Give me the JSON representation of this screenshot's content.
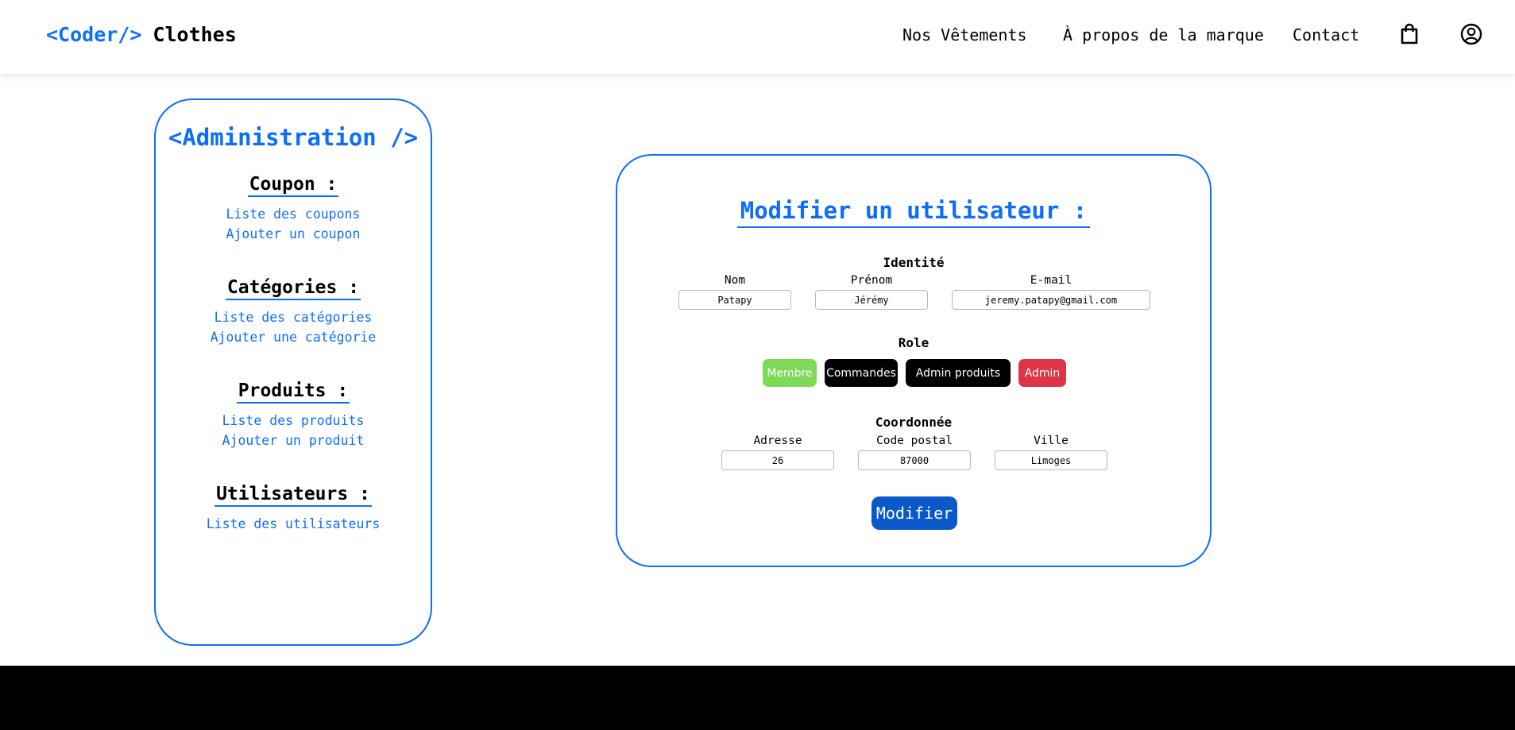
{
  "brand": {
    "code": "<Coder/>",
    "name": "Clothes"
  },
  "nav": {
    "items": [
      "Nos Vêtements",
      "À propos de la marque",
      "Contact"
    ],
    "icons": [
      "shopping-bag-icon",
      "user-circle-icon"
    ]
  },
  "sidebar": {
    "title": "<Administration />",
    "sections": [
      {
        "heading": "Coupon :",
        "links": [
          "Liste des coupons",
          "Ajouter un coupon"
        ]
      },
      {
        "heading": "Catégories :",
        "links": [
          "Liste des catégories",
          "Ajouter une catégorie"
        ]
      },
      {
        "heading": "Produits :",
        "links": [
          "Liste des produits",
          "Ajouter un produit"
        ]
      },
      {
        "heading": "Utilisateurs :",
        "links": [
          "Liste des utilisateurs"
        ]
      }
    ]
  },
  "form": {
    "title": "Modifier un utilisateur :",
    "identity": {
      "title": "Identité",
      "fields": [
        {
          "label": "Nom",
          "value": "Patapy"
        },
        {
          "label": "Prénom",
          "value": "Jérémy"
        },
        {
          "label": "E-mail",
          "value": "jeremy.patapy@gmail.com"
        }
      ]
    },
    "role": {
      "title": "Role",
      "options": [
        {
          "label": "Membre",
          "color": "#7ed957"
        },
        {
          "label": "Commandes",
          "color": "#000000"
        },
        {
          "label": "Admin produits",
          "color": "#000000"
        },
        {
          "label": "Admin",
          "color": "#dc3545"
        }
      ]
    },
    "address": {
      "title": "Coordonnée",
      "fields": [
        {
          "label": "Adresse",
          "value": "26"
        },
        {
          "label": "Code postal",
          "value": "87000"
        },
        {
          "label": "Ville",
          "value": "Limoges"
        }
      ]
    },
    "submit_label": "Modifier"
  },
  "colors": {
    "accent": "#0d6efd",
    "submit": "#0a58ca",
    "footer": "#000000"
  }
}
